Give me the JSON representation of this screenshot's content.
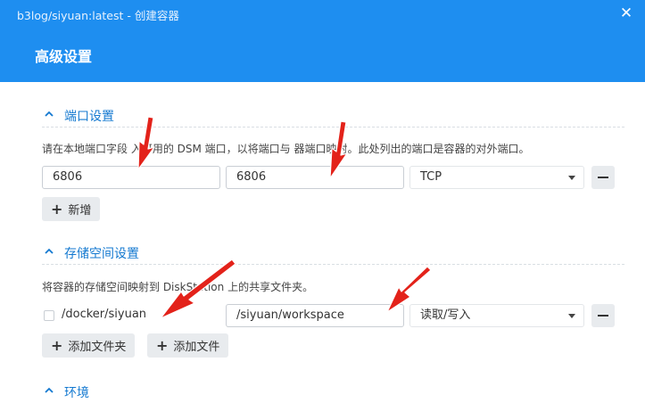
{
  "window": {
    "title": "b3log/siyuan:latest - 创建容器",
    "close_icon": "close-icon",
    "heading": "高级设置"
  },
  "colors": {
    "header_bg": "#1e8ef0",
    "section_title": "#1479d0",
    "annotation_arrow": "#e3221a"
  },
  "port_section": {
    "title": "端口设置",
    "description": "请在本地端口字段 入可用的 DSM 端口，以将端口与   器端口映射。此处列出的端口是容器的对外端口。",
    "row": {
      "local_port": "6806",
      "container_port": "6806",
      "protocol": "TCP"
    },
    "add_label": "新增"
  },
  "storage_section": {
    "title": "存储空间设置",
    "description": "将容器的存储空间映射到 DiskStation 上的共享文件夹。",
    "row": {
      "folder": "/docker/siyuan",
      "mount_path": "/siyuan/workspace",
      "permission": "读取/写入"
    },
    "add_folder_label": "添加文件夹",
    "add_file_label": "添加文件"
  },
  "env_section": {
    "title": "环境"
  }
}
